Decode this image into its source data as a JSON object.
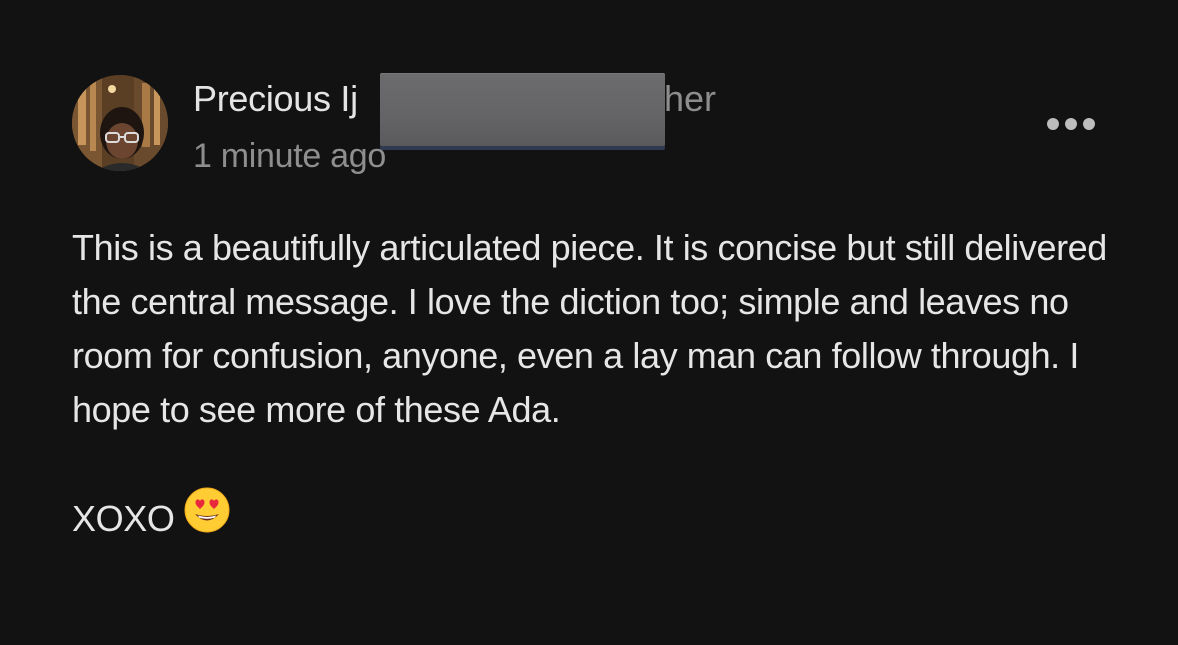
{
  "comment": {
    "author": {
      "name_visible": "Precious Ij",
      "name_suffix_visible": "her",
      "avatar_icon": "user-avatar-photo"
    },
    "timestamp": "1 minute ago",
    "more_icon": "more-horizontal-icon",
    "body": {
      "paragraph_1": "This is a beautifully articulated piece. It is concise but still delivered the central message. I love the diction too; simple and leaves no room for confusion, anyone, even a lay man can follow through. I hope to see more of these Ada.",
      "paragraph_2": "XOXO",
      "emoji_icon": "smiling-face-with-heart-eyes-emoji"
    },
    "colors": {
      "background": "#121212",
      "primary_text": "#e6e6e6",
      "secondary_text": "#8e8e8e",
      "redaction": "#666668"
    }
  }
}
